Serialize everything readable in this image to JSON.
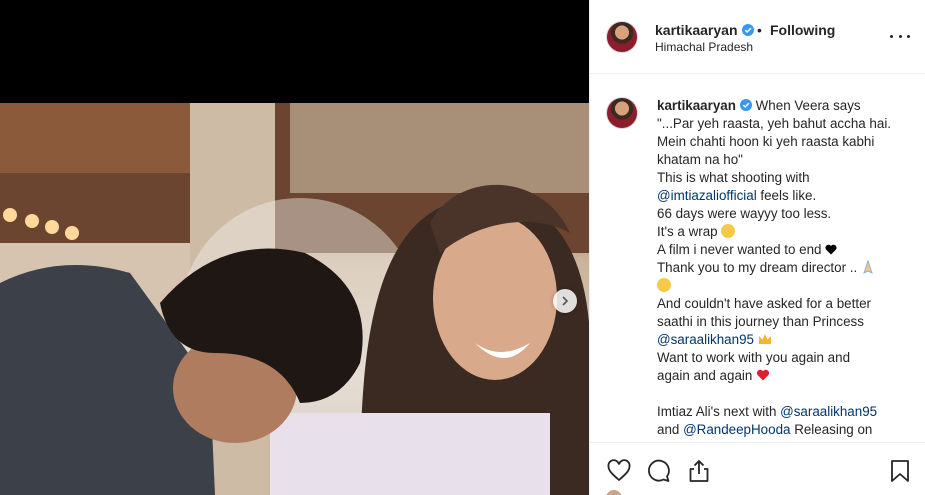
{
  "post": {
    "author": "kartikaaryan",
    "verified": true,
    "follow_separator": "•",
    "follow_status": "Following",
    "location": "Himachal Pradesh"
  },
  "caption": {
    "author": "kartikaaryan",
    "line1_tail": "When Veera says",
    "line2": "\"...Par yeh raasta, yeh bahut accha hai.",
    "line3": "Mein chahti hoon ki yeh raasta kabhi",
    "line4": "khatam na ho\"",
    "line5": "This is what shooting with",
    "line6_mention": "@imtiazaliofficial",
    "line6_tail": " feels like.",
    "line7": "66 days were wayyy too less.",
    "line8": "It's a wrap",
    "line9": "A film i never wanted to end",
    "line10": "Thank you to my dream director ..",
    "line12": "And couldn't have asked for a better",
    "line13": "saathi in this journey than Princess",
    "line14_mention": "@saraalikhan95",
    "line15": "Want to work with you again and",
    "line16": "again and again",
    "line18_head": "Imtiaz Ali's next with ",
    "line18_mention": "@saraalikhan95",
    "line19_head": "and ",
    "line19_mention": "@RandeepHooda",
    "line19_tail": " Releasing on"
  },
  "icons": {
    "verified": "verified-badge-icon",
    "more": "more-options-icon",
    "like": "heart-icon",
    "comment": "comment-icon",
    "share": "share-icon",
    "save": "bookmark-icon",
    "carousel": "chevron-right-icon"
  },
  "colors": {
    "verified": "#3897f0",
    "mention": "#003569",
    "text": "#262626",
    "divider": "#efefef"
  }
}
